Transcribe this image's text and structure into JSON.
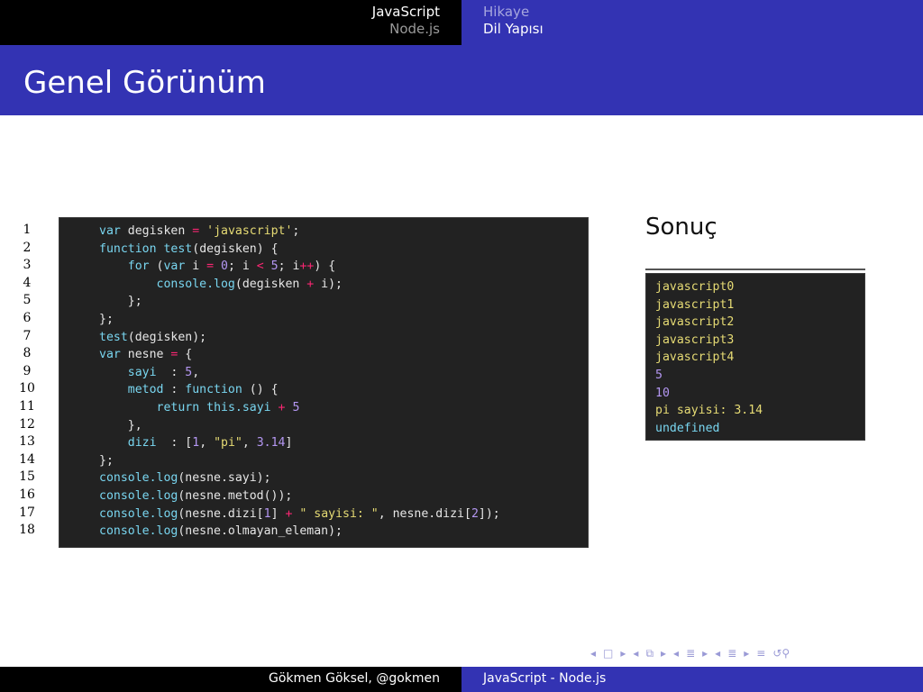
{
  "nav": {
    "left": {
      "active": "JavaScript",
      "inactive": "Node.js"
    },
    "right": {
      "inactive": "Hikaye",
      "active": "Dil Yapısı"
    }
  },
  "slide_title": "Genel Görünüm",
  "line_numbers": [
    "1",
    "2",
    "3",
    "4",
    "5",
    "6",
    "7",
    "8",
    "9",
    "10",
    "11",
    "12",
    "13",
    "14",
    "15",
    "16",
    "17",
    "18"
  ],
  "result": {
    "title": "Sonuç",
    "lines": [
      "javascript0",
      "javascript1",
      "javascript2",
      "javascript3",
      "javascript4",
      "5",
      "10",
      "pi sayisi: 3.14",
      "undefined"
    ]
  },
  "footer": {
    "author": "Gökmen Göksel, @gokmen",
    "talk": "JavaScript - Node.js"
  },
  "nav_icons": [
    "triangle-left-icon",
    "frame-icon",
    "triangle-right-icon",
    "triangle-left-icon",
    "frames-icon",
    "triangle-right-icon",
    "triangle-left-icon",
    "section-icon",
    "triangle-right-icon",
    "triangle-left-icon",
    "subsection-icon",
    "triangle-right-icon",
    "align-icon",
    "search-zoom-icon"
  ],
  "colors": {
    "nav_blue": "#3333b3",
    "code_bg": "#222222",
    "keyword": "#79d6f0",
    "string": "#e6db74",
    "number": "#b497f2",
    "operator": "#f92672"
  }
}
